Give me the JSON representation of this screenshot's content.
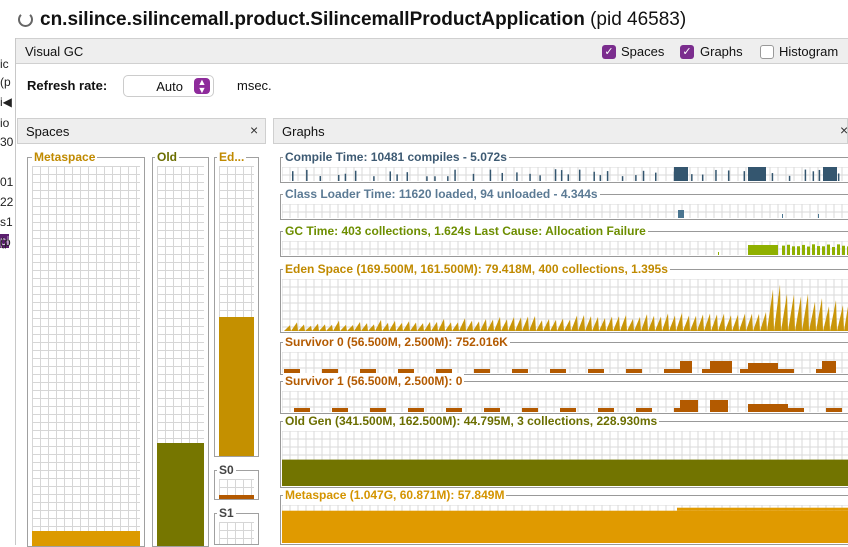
{
  "title": {
    "app": "cn.silince.silincemall.product.SilincemallProductApplication",
    "pid": "(pid 46583)"
  },
  "left_stub": [
    "ic",
    "(p",
    "i◀",
    "io",
    "30",
    "01",
    "22",
    "s1",
    "pi",
    "(p"
  ],
  "tab": {
    "label": "Visual GC"
  },
  "toggles": [
    {
      "label": "Spaces",
      "checked": true
    },
    {
      "label": "Graphs",
      "checked": true
    },
    {
      "label": "Histogram",
      "checked": false
    }
  ],
  "refresh": {
    "label": "Refresh rate:",
    "value": "Auto",
    "unit": "msec."
  },
  "spaces_panel": {
    "title": "Spaces",
    "close": "×",
    "columns": [
      {
        "label": "Metaspace",
        "fill": 0.04,
        "color": "#dc9a00"
      },
      {
        "label": "Old",
        "fill": 0.27,
        "color": "#767600"
      },
      {
        "label": "Ed...",
        "fill": 0.48,
        "color": "#c49000"
      },
      {
        "label": "S0",
        "fill": 0.2,
        "color": "#b35900"
      },
      {
        "label": "S1",
        "fill": 0.0,
        "color": "#b35900"
      }
    ]
  },
  "graphs_panel": {
    "title": "Graphs",
    "close": "×",
    "graphs": [
      {
        "label": "Compile Time: 10481 compiles - 5.072s",
        "label_color": "#3d5a73",
        "color": "#34566f",
        "kind": "ticks"
      },
      {
        "label": "Class Loader Time: 11620 loaded, 94 unloaded - 4.344s",
        "label_color": "#5b7a94",
        "color": "#4a7590",
        "kind": "sparse"
      },
      {
        "label": "GC Time: 403 collections, 1.624s  Last Cause: Allocation Failure",
        "label_color": "#6d8e00",
        "color": "#8fb000",
        "kind": "gc"
      },
      {
        "label": "Eden Space (169.500M, 161.500M): 79.418M, 400 collections, 1.395s",
        "label_color": "#c08a00",
        "color": "#c9960a",
        "kind": "saw"
      },
      {
        "label": "Survivor 0 (56.500M, 2.500M): 752.016K",
        "label_color": "#b35a00",
        "color": "#b35a00",
        "kind": "blocks"
      },
      {
        "label": "Survivor 1 (56.500M, 2.500M): 0",
        "label_color": "#b35a00",
        "color": "#b35a00",
        "kind": "blocks"
      },
      {
        "label": "Old Gen (341.500M, 162.500M): 44.795M, 3 collections, 228.930ms",
        "label_color": "#6b6e00",
        "color": "#727400",
        "kind": "flat",
        "level": 0.48
      },
      {
        "label": "Metaspace (1.047G, 60.871M): 57.849M",
        "label_color": "#d49400",
        "color": "#e09a00",
        "kind": "flat",
        "level": 0.85
      }
    ]
  }
}
